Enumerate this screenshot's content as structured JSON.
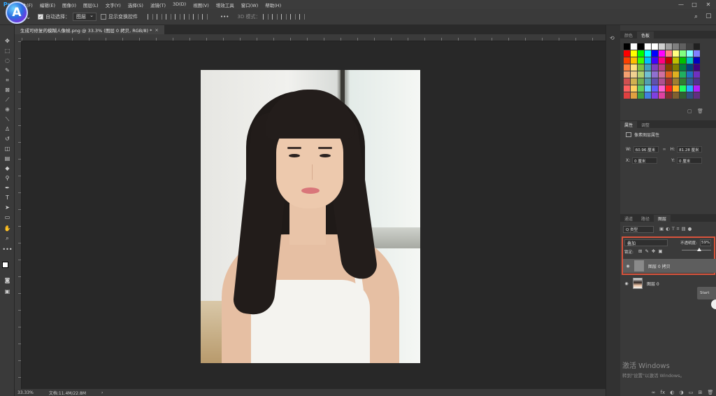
{
  "menubar": {
    "items": [
      "文件(F)",
      "编辑(E)",
      "图像(I)",
      "图层(L)",
      "文字(Y)",
      "选择(S)",
      "滤镜(T)",
      "3D(D)",
      "视图(V)",
      "增效工具",
      "窗口(W)",
      "帮助(H)"
    ],
    "minimize": "—",
    "maximize": "□",
    "close": "✕"
  },
  "optionsbar": {
    "auto_select_label": "自动选择：",
    "auto_select_value": "图层",
    "show_transform_label": "显示变换控件",
    "more": "•••",
    "mode_label": "3D 模式："
  },
  "document": {
    "tab_title": "生成可修复的模糊人像帧.png @ 33.3% (图层 0 拷贝, RGB/8) *",
    "close": "×"
  },
  "statusbar": {
    "zoom": "33.33%",
    "doc_size": "文档:11.4M/22.8M",
    "arrow": "›"
  },
  "swatches_panel": {
    "tabs": [
      "颜色",
      "色板"
    ],
    "active": "色板",
    "rows": [
      [
        "#000000",
        "#ffffff",
        "#000000",
        "#ffffff",
        "#ffffff",
        "#d0d0d0",
        "#a0a0a0",
        "#808080",
        "#606060",
        "#404040",
        "#202020"
      ],
      [
        "#ff0000",
        "#ffff00",
        "#00ff00",
        "#00ffff",
        "#0000ff",
        "#ff00ff",
        "#ff8080",
        "#ffff80",
        "#80ff80",
        "#80ffff",
        "#8080ff"
      ],
      [
        "#ff4000",
        "#ffc000",
        "#40ff00",
        "#00c0ff",
        "#4000ff",
        "#ff0080",
        "#c00000",
        "#c0c000",
        "#00c000",
        "#00c0c0",
        "#0000c0"
      ],
      [
        "#ff8040",
        "#ffe080",
        "#80c040",
        "#40a0c0",
        "#8040c0",
        "#c04080",
        "#804000",
        "#808000",
        "#008040",
        "#004080",
        "#400080"
      ],
      [
        "#f4a070",
        "#f0d090",
        "#b0d070",
        "#70c0d0",
        "#9070d0",
        "#d070a0",
        "#e06020",
        "#e0b020",
        "#20b060",
        "#2070c0",
        "#7030c0"
      ],
      [
        "#d05050",
        "#d0b050",
        "#70b050",
        "#50a0b0",
        "#6050b0",
        "#b05090",
        "#a03030",
        "#a08030",
        "#308030",
        "#306090",
        "#503090"
      ],
      [
        "#ff6060",
        "#ffd060",
        "#60d060",
        "#60d0ff",
        "#6060ff",
        "#ff60d0",
        "#ff2020",
        "#ffb020",
        "#20ff60",
        "#20b0ff",
        "#b020ff"
      ],
      [
        "#e04040",
        "#e0a040",
        "#40a040",
        "#4080e0",
        "#8040e0",
        "#e040a0",
        "#803030",
        "#806030",
        "#306030",
        "#305080",
        "#603080"
      ]
    ]
  },
  "properties_panel": {
    "tabs": [
      "属性",
      "调整"
    ],
    "active": "属性",
    "subtitle": "像素图层属性",
    "w_label": "W:",
    "w_value": "60.96 厘米",
    "h_label": "H:",
    "h_value": "81.28 厘米",
    "x_label": "X:",
    "x_value": "0 厘米",
    "y_label": "Y:",
    "y_value": "0 厘米"
  },
  "layers_panel": {
    "tabs": [
      "通道",
      "路径",
      "图层"
    ],
    "active": "图层",
    "filter_label": "Q 类型",
    "blend_mode": "叠加",
    "opacity_label": "不透明度:",
    "opacity_value": "59%",
    "lock_label": "锁定:",
    "layers": [
      {
        "name": "图层 0 拷贝",
        "selected": true,
        "thumb_color": "#8a8a8a"
      },
      {
        "name": "图层 0",
        "selected": false,
        "thumb_color": "#cfc6bd"
      }
    ],
    "bottom_icons": [
      "∞",
      "fx",
      "◐",
      "◑",
      "▭",
      "⊞",
      "🗑"
    ]
  },
  "watermark": {
    "title": "激活 Windows",
    "subtitle": "转到\"设置\"以激活 Windows。"
  },
  "side_tab": {
    "label": "Start"
  },
  "colors": {
    "accent_red": "#d9533c",
    "ps_blue": "#31a8ff"
  }
}
